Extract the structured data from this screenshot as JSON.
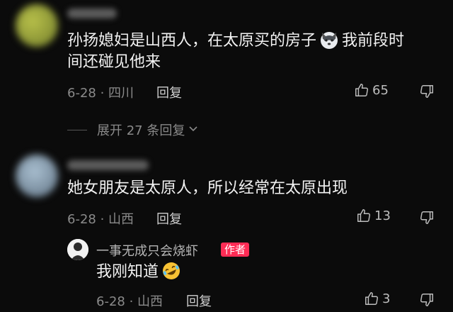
{
  "comments": [
    {
      "text_line1_a": "孙扬媳妇是山西人，在太原买的房子",
      "text_line1_b": "我前段时",
      "text_line2": "间还碰见他来",
      "emoji": "wolf-face",
      "date_location": "6-28 · 四川",
      "reply_label": "回复",
      "likes": "65"
    },
    {
      "text": "她女朋友是太原人，所以经常在太原出现",
      "date_location": "6-28 · 山西",
      "reply_label": "回复",
      "likes": "13"
    }
  ],
  "expand_replies": {
    "label": "展开 27 条回复"
  },
  "reply": {
    "username": "一事无成只会烧虾",
    "author_badge": "作者",
    "text": "我刚知道",
    "emoji": "rolling-on-floor-laughing",
    "date_location": "6-28 · 山西",
    "reply_label": "回复",
    "likes": "3"
  },
  "colors": {
    "background": "#0b0b0b",
    "author_badge": "#fe2c55",
    "meta_text": "#8a8a8a"
  }
}
